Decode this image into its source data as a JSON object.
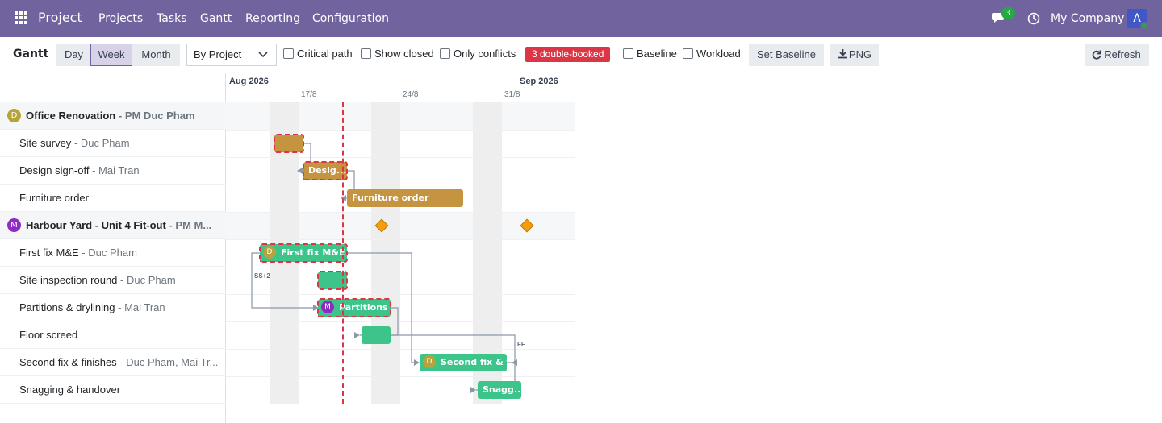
{
  "navbar": {
    "brand": "Project",
    "menu": [
      "Projects",
      "Tasks",
      "Gantt",
      "Reporting",
      "Configuration"
    ],
    "messages_count": "3",
    "company": "My Company",
    "user_initial": "A",
    "colors": {
      "bar": "#71639e",
      "online": "#28a745",
      "avatar": "#3f58c6"
    }
  },
  "toolbar": {
    "title": "Gantt",
    "scale_buttons": [
      "Day",
      "Week",
      "Month"
    ],
    "active_scale": "Week",
    "group_by": "By Project",
    "checkboxes": {
      "critical_path": "Critical path",
      "show_closed": "Show closed",
      "only_conflicts": "Only conflicts",
      "baseline": "Baseline",
      "workload": "Workload"
    },
    "conflicts_badge": "3 double-booked",
    "set_baseline": "Set Baseline",
    "png": "PNG",
    "refresh": "Refresh"
  },
  "timeline": {
    "months": [
      "Aug 2026",
      "Sep 2026"
    ],
    "weeks": [
      "17/8",
      "24/8",
      "31/8"
    ]
  },
  "rows": [
    {
      "type": "project",
      "name": "Office Renovation",
      "sub": "- PM Duc Pham",
      "avatar": "D",
      "avatar_color": "#b5a33b"
    },
    {
      "type": "task",
      "name": "Site survey",
      "sub": "- Duc Pham"
    },
    {
      "type": "task",
      "name": "Design sign-off",
      "sub": "- Mai Tran"
    },
    {
      "type": "task",
      "name": "Furniture order",
      "sub": ""
    },
    {
      "type": "project",
      "name": "Harbour Yard - Unit 4 Fit-out",
      "sub": "- PM M...",
      "avatar": "M",
      "avatar_color": "#8e2bc4"
    },
    {
      "type": "task",
      "name": "First fix M&E",
      "sub": "- Duc Pham"
    },
    {
      "type": "task",
      "name": "Site inspection round",
      "sub": "- Duc Pham"
    },
    {
      "type": "task",
      "name": "Partitions & drylining",
      "sub": "- Mai Tran"
    },
    {
      "type": "task",
      "name": "Floor screed",
      "sub": ""
    },
    {
      "type": "task",
      "name": "Second fix & finishes",
      "sub": "- Duc Pham, Mai Tr..."
    },
    {
      "type": "task",
      "name": "Snagging & handover",
      "sub": ""
    }
  ],
  "bars": {
    "site_survey": "",
    "design_signoff": "Desig...",
    "furniture_order": "Furniture order",
    "first_fix": "First fix M&E",
    "first_fix_avatar": "D",
    "site_inspection": "",
    "partitions": "Partitions ...",
    "partitions_avatar": "M",
    "floor_screed": "",
    "second_fix": "Second fix & f...",
    "second_fix_avatar": "D",
    "snagging": "Snagg..."
  },
  "dependency_labels": {
    "ss": "SS+2",
    "ff": "FF"
  },
  "colors": {
    "office_bar": "#c49440",
    "harbour_bar": "#3dc48a",
    "conflict": "#dc3545",
    "milestone": "#f59e0b",
    "today": "#dc3545"
  }
}
